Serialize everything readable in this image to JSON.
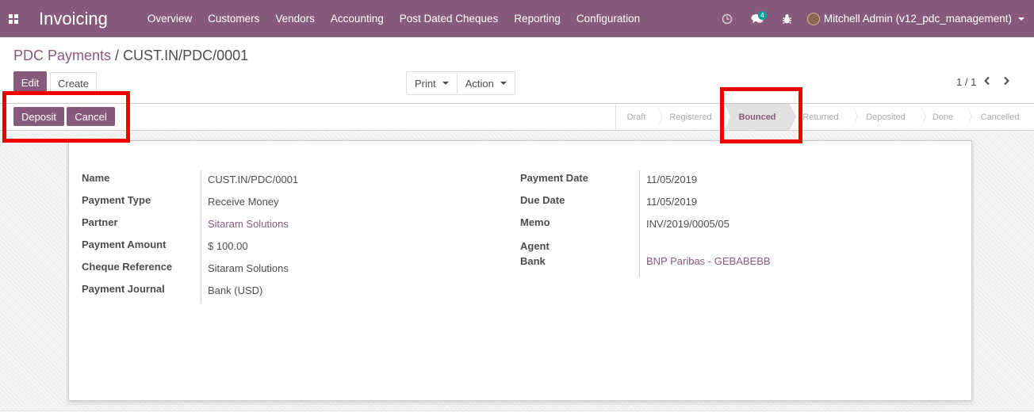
{
  "navbar": {
    "app_title": "Invoicing",
    "menu": [
      "Overview",
      "Customers",
      "Vendors",
      "Accounting",
      "Post Dated Cheques",
      "Reporting",
      "Configuration"
    ],
    "messages_badge": "4",
    "user_name": "Mitchell Admin (v12_pdc_management)",
    "bg_color": "#875a7b"
  },
  "breadcrumb": {
    "parent": "PDC Payments",
    "separator": "/",
    "current": "CUST.IN/PDC/0001"
  },
  "control_panel": {
    "edit_label": "Edit",
    "create_label": "Create",
    "print_label": "Print",
    "action_label": "Action",
    "pager": "1 / 1"
  },
  "statusbar": {
    "deposit_label": "Deposit",
    "cancel_label": "Cancel",
    "stages": [
      "Draft",
      "Registered",
      "Bounced",
      "Returned",
      "Deposited",
      "Done",
      "Cancelled"
    ],
    "active_stage": "Bounced"
  },
  "form": {
    "left": [
      {
        "label": "Name",
        "value": "CUST.IN/PDC/0001"
      },
      {
        "label": "Payment Type",
        "value": "Receive Money"
      },
      {
        "label": "Partner",
        "value": "Sitaram Solutions"
      },
      {
        "label": "Payment Amount",
        "value": "$ 100.00"
      },
      {
        "label": "Cheque Reference",
        "value": "Sitaram Solutions"
      },
      {
        "label": "Payment Journal",
        "value": "Bank (USD)"
      }
    ],
    "right": [
      {
        "label": "Payment Date",
        "value": "11/05/2019"
      },
      {
        "label": "Due Date",
        "value": "11/05/2019"
      },
      {
        "label": "Memo",
        "value": "INV/2019/0005/05"
      },
      {
        "label": "Agent Bank",
        "value": "BNP Paribas - GEBABEBB"
      }
    ]
  },
  "highlight_color": "#ee0000"
}
